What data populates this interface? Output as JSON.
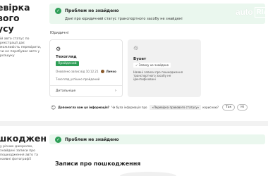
{
  "left": {
    "title1": "евірка\nвого\nусу",
    "desc1": "ій авто статус по реєстрації дає можливість перевірити, чи не перебуває авто у розшуку",
    "title2": "шкодження",
    "desc2": "у різних джерелах, знайдені записи про пошкодження авто та наявні фотографії"
  },
  "banner1": {
    "title": "Проблем не знайдено",
    "subtitle": "Дані про юридичний статус транспортного засобу не знайдені"
  },
  "logo": {
    "auto": "auto",
    "ria": "RIA"
  },
  "section_label": "Юридичні",
  "card1": {
    "title": "Техогляд",
    "badge": "Пройдений",
    "meta": "Оновлено запис від 10.12.21",
    "meta_name": "Личко",
    "result": "Техогляд успішно пройдений",
    "link": "Детальніше",
    "arrow": "›"
  },
  "card2": {
    "title": "Бухет",
    "status": "✓ Запису не знайдено",
    "desc": "Наявні записи про пошкодження транспортного засобу не ідентифіковані"
  },
  "feedback": {
    "question": "Допомогла вам ця інформація?",
    "text": "Чи була інформація про «Перевірка правового статусу» корисною?",
    "chip": "«Перевірка правового статусу»",
    "text_pre": "Чи була інформація про",
    "text_post": "корисною?",
    "yes": "Так",
    "no": "Ні"
  },
  "banner2": {
    "title": "Проблем не знайдено"
  },
  "damage": {
    "title": "Записи про пошкодження"
  },
  "colors": {
    "accent_green": "#2e9e57",
    "banner_bg": "#eaf7ee"
  }
}
